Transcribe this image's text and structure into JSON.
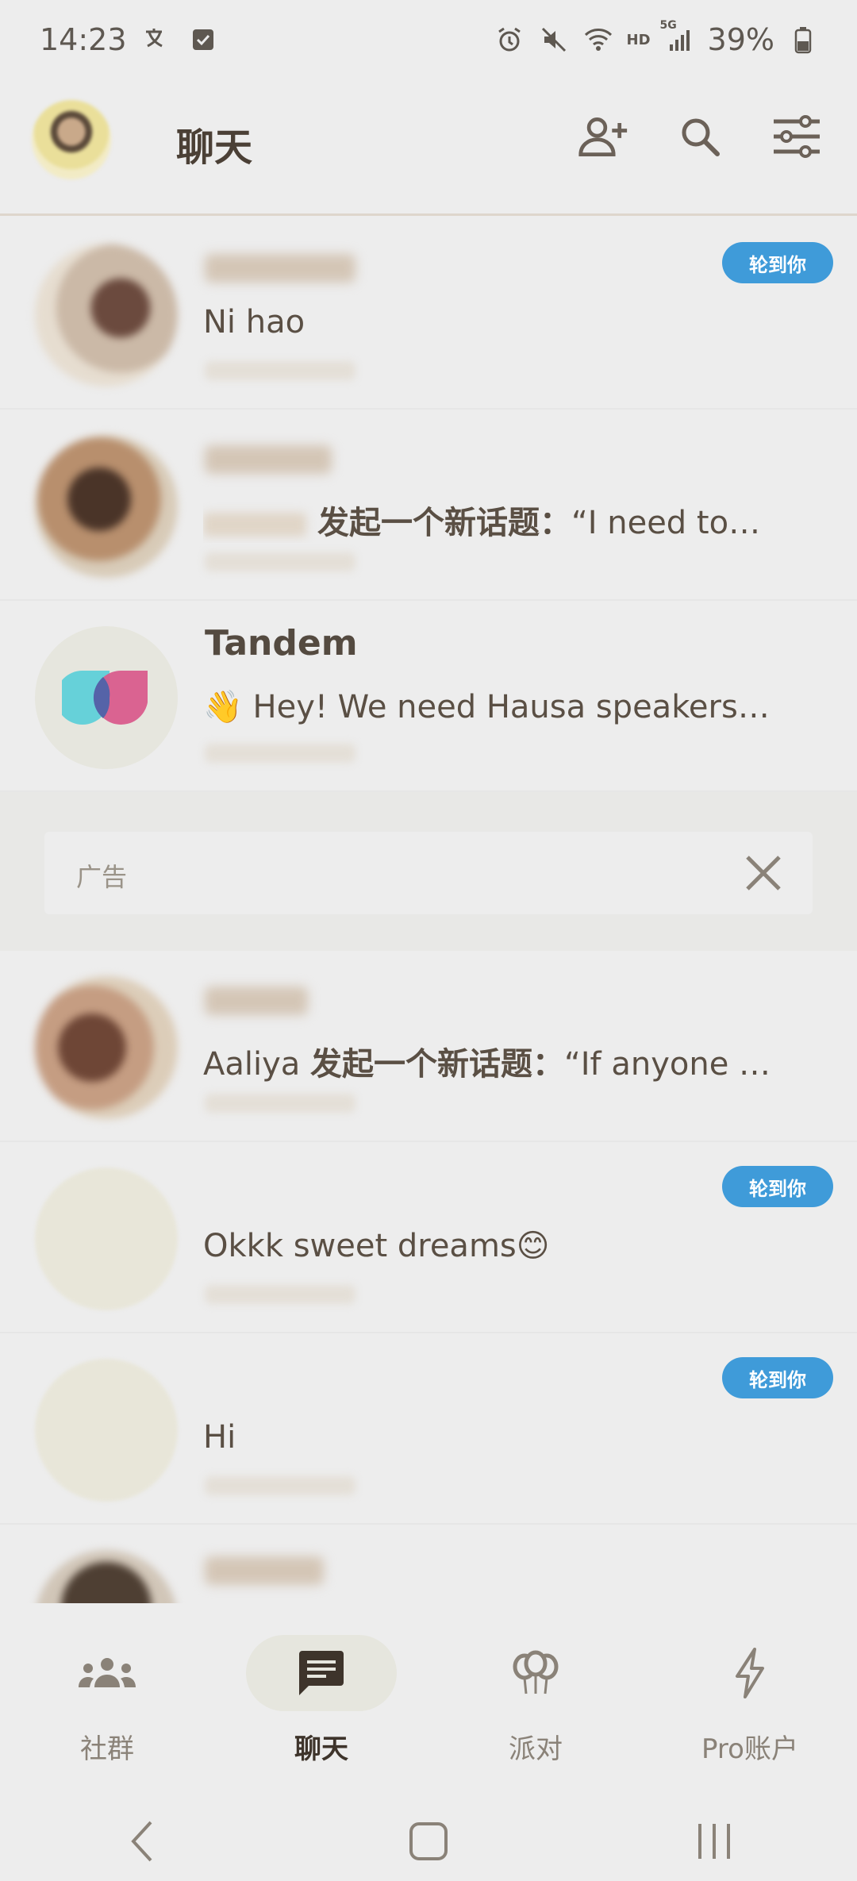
{
  "status_bar": {
    "time": "14:23",
    "battery": "39%",
    "network_hd": "HD",
    "network_5g": "5G"
  },
  "header": {
    "title": "聊天"
  },
  "chats": [
    {
      "message": "Ni hao",
      "badge": "轮到你"
    },
    {
      "message_prefix": "发起一个新话题：",
      "message": "“I need to…"
    },
    {
      "name": "Tandem",
      "message": "👋 Hey! We need Hausa speakers li…"
    },
    {
      "name_visible": "Aaliya",
      "message_prefix": "发起一个新话题：",
      "message": "“If anyone …"
    },
    {
      "message": "Okkk sweet dreams😊",
      "badge": "轮到你"
    },
    {
      "message": "Hi",
      "badge": "轮到你"
    }
  ],
  "ad": {
    "label": "广告"
  },
  "bottom_nav": {
    "items": [
      {
        "label": "社群",
        "icon": "community-icon"
      },
      {
        "label": "聊天",
        "icon": "chat-icon",
        "active": true
      },
      {
        "label": "派对",
        "icon": "party-balloons-icon"
      },
      {
        "label": "Pro账户",
        "icon": "lightning-icon"
      }
    ]
  },
  "colors": {
    "background": "#ededed",
    "badge": "#3f9bd9",
    "text_primary": "#4b4036"
  }
}
